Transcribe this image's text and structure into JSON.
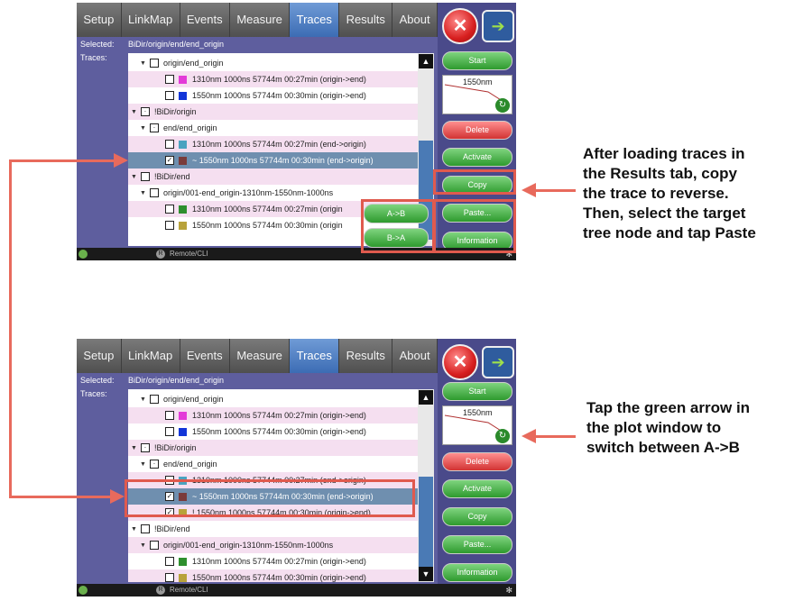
{
  "tabs": [
    "Setup",
    "LinkMap",
    "Events",
    "Measure",
    "Traces",
    "Results",
    "About"
  ],
  "active_tab": "Traces",
  "labels": {
    "selected": "Selected:",
    "traces": "Traces:"
  },
  "side": {
    "close": "✕",
    "forward": "➔",
    "start": "Start",
    "plot_label": "1550nm",
    "delete": "Delete",
    "activate": "Activate",
    "copy": "Copy",
    "paste": "Paste...",
    "information": "Information"
  },
  "status": {
    "remote": "Remote/CLI",
    "icon": "✻"
  },
  "top": {
    "selected_path": "BiDir/origin/end/end_origin",
    "tree": [
      {
        "text": "origin/end_origin"
      },
      {
        "text": "1310nm 1000ns 57744m 00:27min (origin->end)"
      },
      {
        "text": "1550nm 1000ns 57744m 00:30min (origin->end)"
      },
      {
        "text": "!BiDir/origin"
      },
      {
        "text": "end/end_origin"
      },
      {
        "text": "1310nm 1000ns 57744m 00:27min (end->origin)"
      },
      {
        "text": "~ 1550nm 1000ns 57744m 00:30min (end->origin)"
      },
      {
        "text": "!BiDir/end"
      },
      {
        "text": "origin/001-end_origin-1310nm-1550nm-1000ns"
      },
      {
        "text": "1310nm 1000ns 57744m 00:27min (origin"
      },
      {
        "text": "1550nm 1000ns 57744m 00:30min (origin"
      }
    ],
    "ab_buttons": [
      "A->B",
      "B->A"
    ]
  },
  "bottom": {
    "selected_path": "BiDir/origin/end/end_origin",
    "tree": [
      {
        "text": "origin/end_origin"
      },
      {
        "text": "1310nm 1000ns 57744m 00:27min (origin->end)"
      },
      {
        "text": "1550nm 1000ns 57744m 00:30min (origin->end)"
      },
      {
        "text": "!BiDir/origin"
      },
      {
        "text": "end/end_origin"
      },
      {
        "text": "1310nm 1000ns 57744m 00:27min (end->origin)"
      },
      {
        "text": "~ 1550nm 1000ns 57744m 00:30min (end->origin)"
      },
      {
        "text": "! 1550nm 1000ns 57744m 00:30min (origin->end)"
      },
      {
        "text": "!BiDir/end"
      },
      {
        "text": "origin/001-end_origin-1310nm-1550nm-1000ns"
      },
      {
        "text": "1310nm 1000ns 57744m 00:27min (origin->end)"
      },
      {
        "text": "1550nm 1000ns 57744m 00:30min (origin->end)"
      }
    ]
  },
  "annotations": {
    "top_caption": [
      "After loading traces in",
      "the Results tab, copy",
      "the trace to reverse.",
      "Then, select the target",
      "tree node and tap Paste"
    ],
    "bottom_caption": [
      "Tap the green arrow in",
      "the plot window  to",
      "switch between A->B"
    ]
  },
  "colors": {
    "accent_annotation": "#e05a4e",
    "active_tab": "#3c6cb4",
    "magenta": "#e33bd8",
    "blue": "#1235d8",
    "teal": "#4aa3c0",
    "maroon": "#7a3b3b",
    "green": "#2e8f2e",
    "olive": "#b8a23a"
  }
}
